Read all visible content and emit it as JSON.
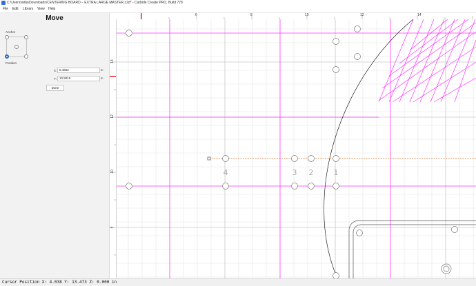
{
  "window": {
    "title": "C:\\Users\\willa\\Downloads\\CENTERING BOARD – EXTRA LARGE MASTER.c2d* - Carbide Create PRO, Build 778"
  },
  "menu": [
    "File",
    "Edit",
    "Library",
    "View",
    "Help"
  ],
  "panel": {
    "title": "Move",
    "anchor_label": "Anchor",
    "position_label": "Position",
    "x_label": "X:",
    "x_value": "6.4652",
    "y_label": "Y:",
    "y_value": "10.5010",
    "unit": "in",
    "done_label": "Done",
    "selected_anchor": "bottom-left"
  },
  "ruler": {
    "top_labels": [
      "6",
      "8",
      "10",
      "12",
      "14"
    ],
    "left_labels": [
      "14",
      "12",
      "10",
      "8"
    ]
  },
  "canvas": {
    "hole_labels": [
      "4",
      "3",
      "2",
      "1"
    ]
  },
  "status": {
    "cursor_text": "Cursor Position X: 4.038 Y: 13.473 Z: 0.000 in"
  },
  "colors": {
    "guide": "#ff33ff",
    "grid": "#dcdcdc",
    "accent_marker": "#e0202a",
    "selection": "#d2691e"
  }
}
